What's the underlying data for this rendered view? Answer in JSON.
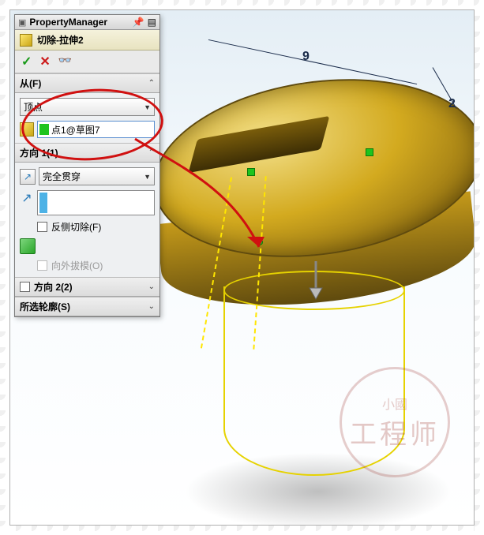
{
  "panel_title": "PropertyManager",
  "feature_name": "切除-拉伸2",
  "actions": {
    "ok": "✓",
    "cancel": "✕",
    "detail": "👓"
  },
  "group_from": {
    "label": "从(F)",
    "start_condition": "顶点",
    "selected_vertex": "点1@草图7"
  },
  "group_dir1": {
    "label": "方向 1(1)",
    "end_condition": "完全贯穿",
    "flip_side_label": "反侧切除(F)",
    "draft_outward_label": "向外拔模(O)"
  },
  "group_dir2": {
    "label": "方向 2(2)"
  },
  "group_contours": {
    "label": "所选轮廓(S)"
  },
  "dimensions": {
    "d1": "9",
    "d2": "2"
  },
  "watermark": {
    "line1": "小國",
    "line2": "工程师"
  }
}
